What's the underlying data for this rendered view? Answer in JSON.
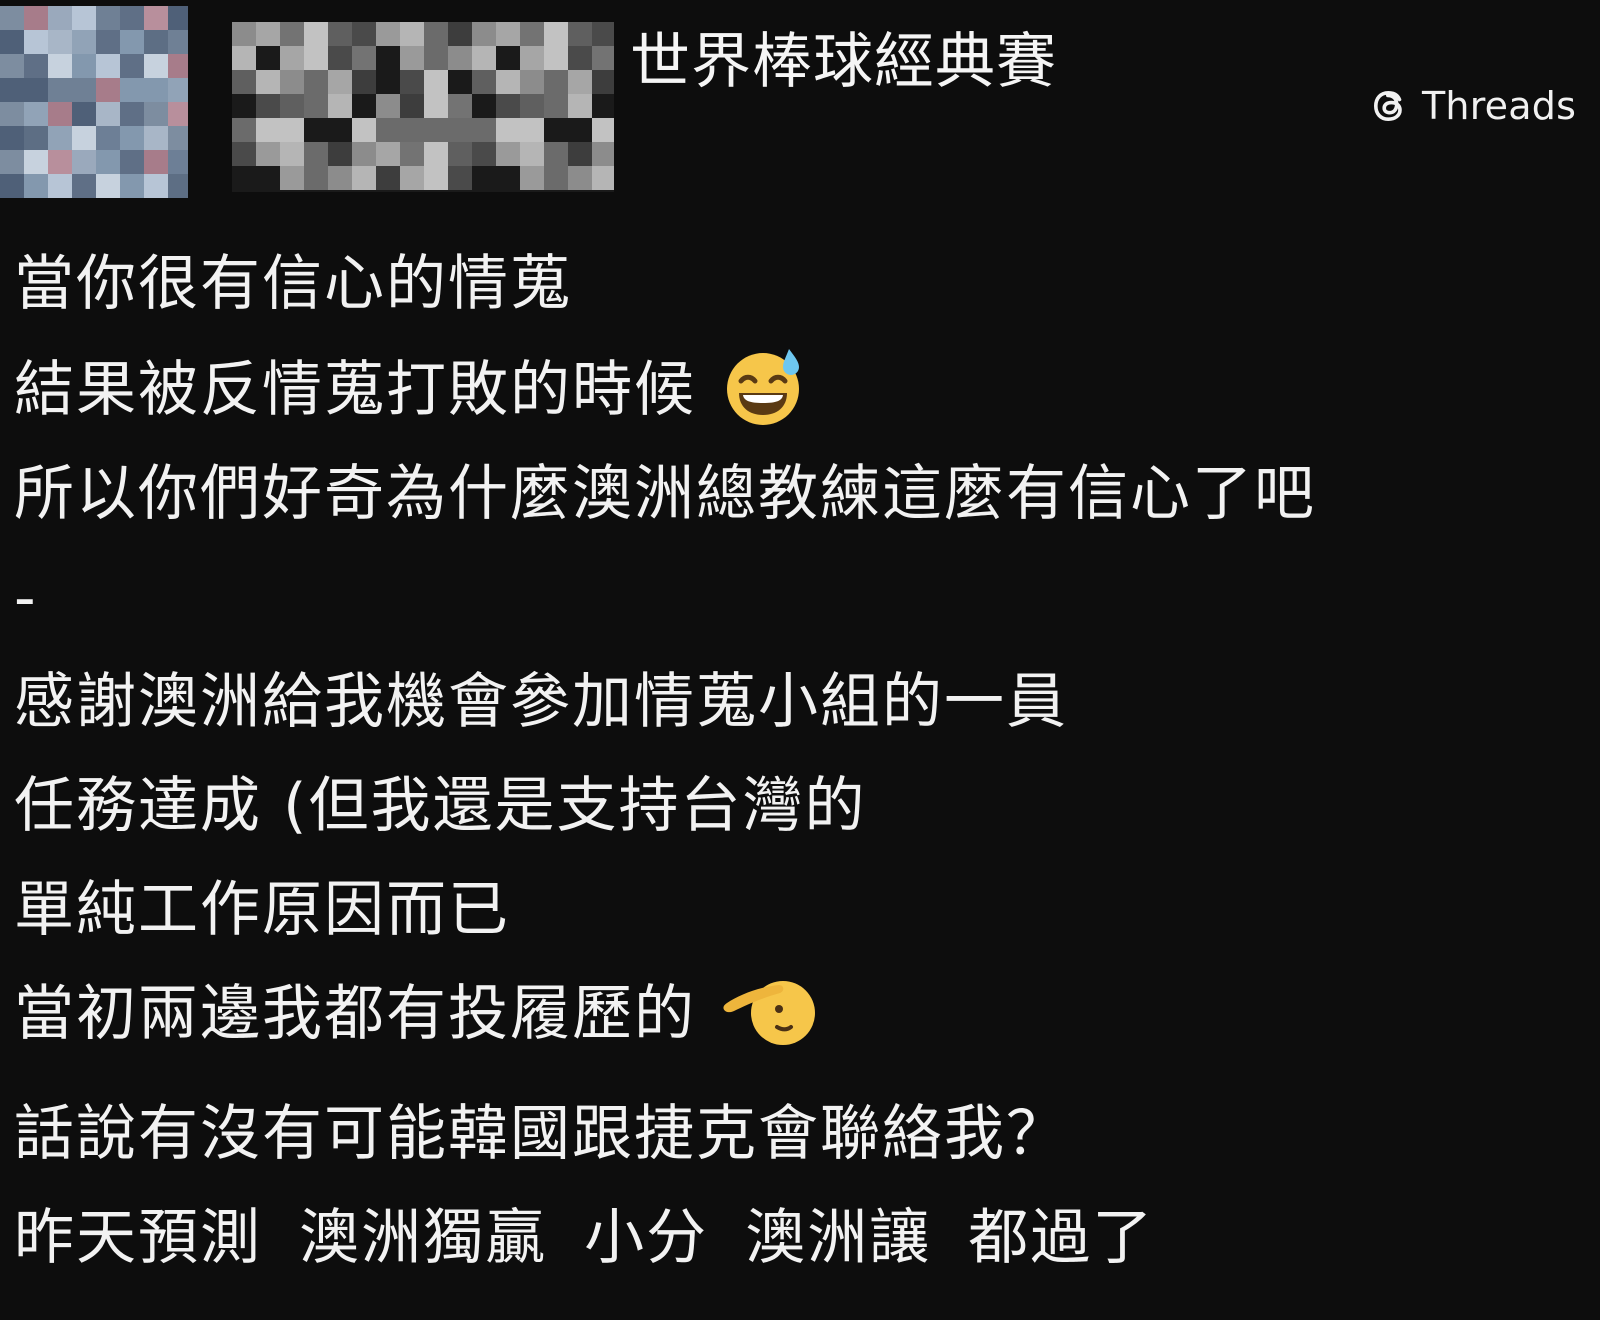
{
  "header": {
    "topic": "世界棒球經典賽",
    "platform": "Threads"
  },
  "post": {
    "lines": [
      "當你很有信心的情蒐",
      "結果被反情蒐打敗的時候",
      "所以你們好奇為什麼澳洲總教練這麼有信心了吧",
      "-",
      "感謝澳洲給我機會參加情蒐小組的一員",
      "任務達成 (但我還是支持台灣的",
      "單純工作原因而已",
      "當初兩邊我都有投履歷的",
      "話說有沒有可能韓國跟捷克會聯絡我？",
      "昨天預測  澳洲獨贏 小分 澳洲讓 都過了"
    ],
    "emojis": {
      "line_2": "grinning-face-with-sweat-icon",
      "line_8": "saluting-face-icon"
    }
  },
  "colors": {
    "background": "#0d0d0d",
    "text": "#f2f2f2",
    "emoji_yellow": "#f6c64a"
  }
}
